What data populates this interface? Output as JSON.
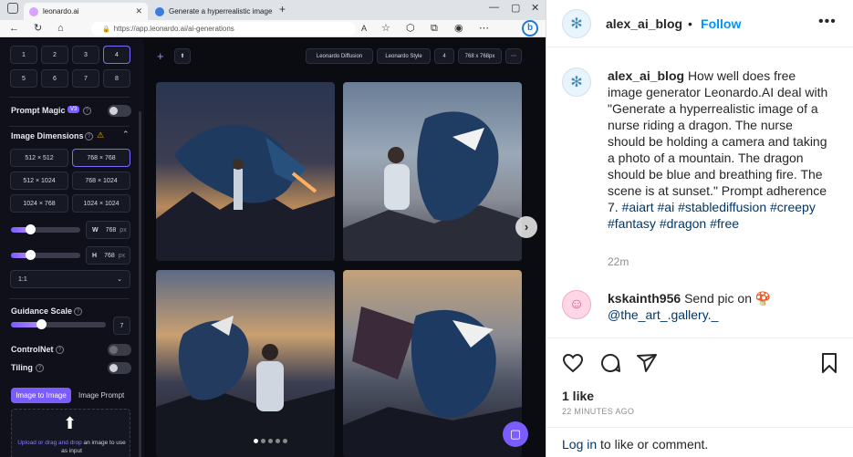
{
  "browser": {
    "tabs": [
      {
        "label": "leonardo.ai"
      },
      {
        "label": "Generate a hyperrealistic image"
      }
    ],
    "url": "https://app.leonardo.ai/ai-generations",
    "font_size_label": "A"
  },
  "leonardo": {
    "count_buttons": [
      "1",
      "2",
      "3",
      "4",
      "5",
      "6",
      "7",
      "8"
    ],
    "selected_count": "4",
    "prompt_magic": {
      "label": "Prompt Magic",
      "badge": "V3",
      "enabled": false
    },
    "image_dimensions": {
      "label": "Image Dimensions",
      "options": [
        "512 × 512",
        "768 × 768",
        "512 × 1024",
        "768 × 1024",
        "1024 × 768",
        "1024 × 1024"
      ],
      "selected": "768 × 768",
      "width_label": "W",
      "width_value": "768",
      "height_label": "H",
      "height_value": "768",
      "unit": "px",
      "aspect": "1:1"
    },
    "guidance": {
      "label": "Guidance Scale",
      "value": "7"
    },
    "controlnet": {
      "label": "ControlNet"
    },
    "tiling": {
      "label": "Tiling"
    },
    "tabs": {
      "image_to_image": "Image to Image",
      "image_prompt": "Image Prompt"
    },
    "upload": {
      "link": "Upload or drag and drop",
      "rest": "an image to use as input"
    },
    "toolbar": {
      "plus": "+",
      "model": "Leonardo Diffusion",
      "style": "Leonardo Style",
      "count": "4",
      "size": "768 x 768px",
      "more": "⋯"
    },
    "carousel_dots": 5
  },
  "instagram": {
    "username": "alex_ai_blog",
    "separator": "•",
    "follow": "Follow",
    "caption_text": "How well does free image generator Leonardo.AI deal with \"Generate a hyperrealistic image of a nurse riding a dragon. The nurse should be holding a camera and taking a photo of a mountain. The dragon should be blue and breathing fire. The scene is at sunset.\" Prompt adherence 7.",
    "hashtags": [
      "#aiart",
      "#ai",
      "#stablediffusion",
      "#creepy",
      "#fantasy",
      "#dragon",
      "#free"
    ],
    "caption_time": "22m",
    "comment": {
      "user": "kskainth956",
      "text": "Send pic on 🍄",
      "mention": "@the_art_.gallery._"
    },
    "likes": "1 like",
    "posted": "22 MINUTES AGO",
    "login_link": "Log in",
    "login_rest": " to like or comment."
  },
  "colors": {
    "accent": "#7b6cff",
    "ig_blue": "#0095f6",
    "ig_link": "#00376b"
  }
}
